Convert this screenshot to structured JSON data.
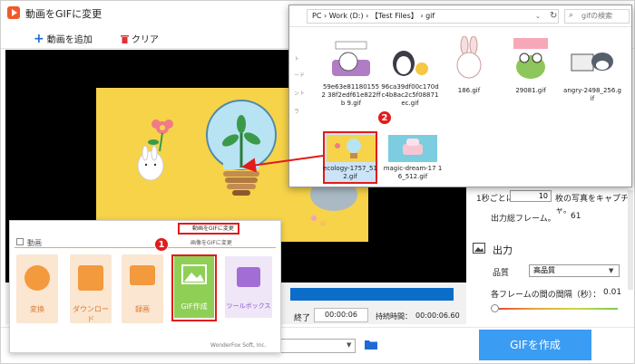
{
  "app": {
    "title": "動画をGIFに変更",
    "toolbar": {
      "add_video": "動画を追加",
      "clear": "クリア"
    }
  },
  "timeline": {
    "end_label": "終了",
    "end_time": "00:00:06",
    "duration_label": "持続時間：",
    "duration_time": "00:00:06.60"
  },
  "right_panel": {
    "frames_per_second_prefix": "1秒ごとに",
    "frames_value": "10",
    "frames_suffix": "枚の写真をキャプチャ。",
    "total_frames_label": "出力総フレーム。",
    "total_frames_value": "61",
    "output_title": "出力",
    "quality_label": "品質",
    "quality_value": "高品質",
    "interval_label": "各フレームの間の間隔（秒）：",
    "interval_value": "0.01"
  },
  "bottom": {
    "create_gif": "GIFを作成"
  },
  "popup": {
    "tab_label": "動画",
    "menu_video_to_gif": "動画をGIFに変更",
    "menu_image_to_gif": "画像をGIFに変更",
    "tiles": [
      {
        "label": "変換",
        "icon": "film-icon",
        "color": "#f29a3d"
      },
      {
        "label": "ダウンロード",
        "icon": "download-icon",
        "color": "#f29a3d"
      },
      {
        "label": "録画",
        "icon": "monitor-icon",
        "color": "#f29a3d"
      },
      {
        "label": "GIF作成",
        "icon": "image-icon",
        "color": "#8fcf56"
      },
      {
        "label": "ツールボックス",
        "icon": "toolbox-icon",
        "color": "#a36dd6"
      }
    ],
    "brand": "WonderFox Soft, Inc."
  },
  "annotations": {
    "step1": "1",
    "step2": "2"
  },
  "explorer": {
    "address": [
      "PC",
      "Work (D:)",
      "【Test Files】",
      "gif"
    ],
    "search_placeholder": "gifの検索",
    "sidebar_fragments": [
      "ト",
      "ード",
      "ント",
      "ラ"
    ],
    "files": [
      {
        "name": "59e63e811801552 38f2edf61e822ffb 9.gif"
      },
      {
        "name": "96ca39df00c170d c4b8ac2c5f08871 ec.gif"
      },
      {
        "name": "186.gif"
      },
      {
        "name": "29081.gif"
      },
      {
        "name": "angry-2498_256.g if"
      },
      {
        "name": "ecology-1757_51 2.gif"
      },
      {
        "name": "magic-dream-17 16_512.gif"
      }
    ]
  },
  "colors": {
    "accent_red": "#e21b1b",
    "create_button": "#3b9cf3",
    "timeline_blue": "#0b6dc8",
    "preview_bg": "#f6d349"
  }
}
